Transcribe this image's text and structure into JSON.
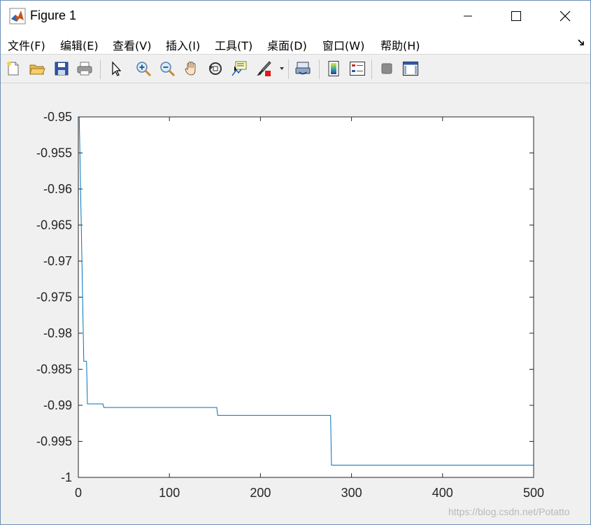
{
  "window": {
    "title": "Figure 1"
  },
  "menu": {
    "items": [
      "文件(F)",
      "编辑(E)",
      "查看(V)",
      "插入(I)",
      "工具(T)",
      "桌面(D)",
      "窗口(W)",
      "帮助(H)"
    ]
  },
  "toolbar": {
    "buttons": [
      "new-figure-icon",
      "open-file-icon",
      "save-icon",
      "print-icon",
      "edit-plot-icon",
      "zoom-in-icon",
      "zoom-out-icon",
      "pan-icon",
      "rotate-3d-icon",
      "data-cursor-icon",
      "brush-icon",
      "link-plot-icon",
      "colorbar-icon",
      "legend-icon",
      "hide-plot-tools-icon",
      "show-plot-tools-icon"
    ]
  },
  "watermark": "https://blog.csdn.net/Potatto",
  "colors": {
    "line": "#0072bd",
    "axis": "#262626"
  },
  "chart_data": {
    "type": "line",
    "title": "",
    "xlabel": "",
    "ylabel": "",
    "xlim": [
      0,
      500
    ],
    "ylim": [
      -1,
      -0.95
    ],
    "xticks": [
      0,
      100,
      200,
      300,
      400,
      500
    ],
    "xtick_labels": [
      "0",
      "100",
      "200",
      "300",
      "400",
      "500"
    ],
    "yticks": [
      -0.95,
      -0.955,
      -0.96,
      -0.965,
      -0.97,
      -0.975,
      -0.98,
      -0.985,
      -0.99,
      -0.995,
      -1
    ],
    "ytick_labels": [
      "-0.95",
      "-0.955",
      "-0.96",
      "-0.965",
      "-0.97",
      "-0.975",
      "-0.98",
      "-0.985",
      "-0.99",
      "-0.995",
      "-1"
    ],
    "grid": false,
    "series": [
      {
        "x": [
          1,
          6,
          6,
          9,
          10,
          11,
          27,
          28,
          152,
          153,
          277,
          278,
          500
        ],
        "y": [
          -0.95,
          -0.9839,
          -0.9839,
          -0.9839,
          -0.9898,
          -0.9898,
          -0.9898,
          -0.9903,
          -0.9903,
          -0.9914,
          -0.9914,
          -0.9983,
          -0.9983
        ]
      }
    ]
  }
}
